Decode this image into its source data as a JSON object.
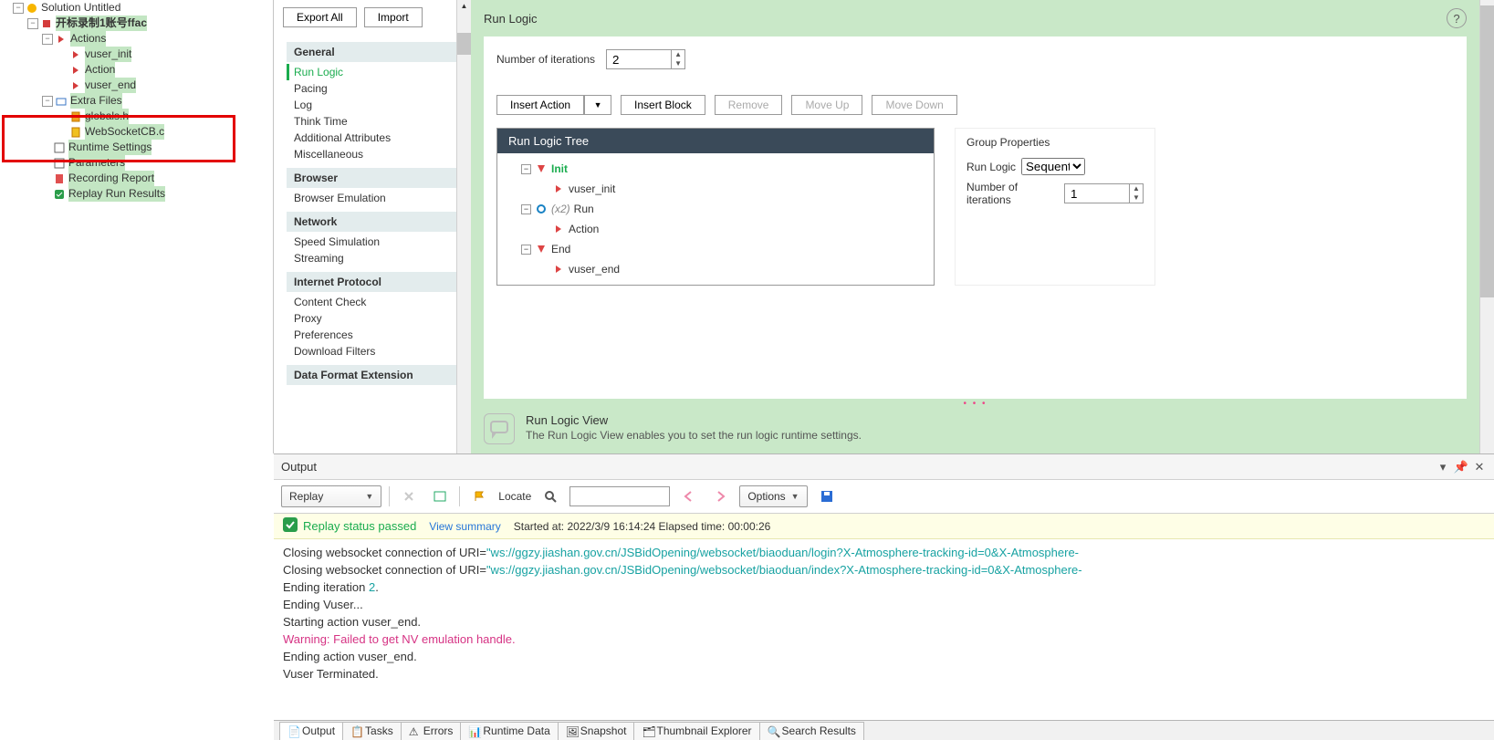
{
  "tree": {
    "root_label": "Solution Untitled",
    "script_label": "开标录制1账号ffac",
    "actions_label": "Actions",
    "actions": [
      "vuser_init",
      "Action",
      "vuser_end"
    ],
    "extra_files_label": "Extra Files",
    "extra_files": [
      "globals.h",
      "WebSocketCB.c"
    ],
    "runtime_settings": "Runtime Settings",
    "parameters": "Parameters",
    "recording_report": "Recording Report",
    "replay_run_results": "Replay Run Results"
  },
  "rts_bar": {
    "export": "Export All",
    "import": "Import"
  },
  "rts_categories": {
    "general_hdr": "General",
    "general": [
      "Run Logic",
      "Pacing",
      "Log",
      "Think Time",
      "Additional Attributes",
      "Miscellaneous"
    ],
    "browser_hdr": "Browser",
    "browser": [
      "Browser Emulation"
    ],
    "network_hdr": "Network",
    "network": [
      "Speed Simulation",
      "Streaming"
    ],
    "ip_hdr": "Internet Protocol",
    "ip": [
      "Content Check",
      "Proxy",
      "Preferences",
      "Download Filters"
    ],
    "dfe_hdr": "Data Format Extension"
  },
  "rts_main": {
    "title": "Run Logic",
    "iter_label": "Number of iterations",
    "iter_value": "2",
    "buttons": {
      "insert_action": "Insert Action",
      "insert_block": "Insert Block",
      "remove": "Remove",
      "move_up": "Move Up",
      "move_down": "Move Down"
    },
    "tree_hdr": "Run Logic Tree",
    "tree": {
      "init": "Init",
      "init_child": "vuser_init",
      "run_prefix": "(x2)",
      "run": "Run",
      "run_child": "Action",
      "end": "End",
      "end_child": "vuser_end"
    },
    "group_props": {
      "title": "Group Properties",
      "rl_label": "Run Logic",
      "rl_value": "Sequential",
      "ni_label": "Number of iterations",
      "ni_value": "1"
    },
    "info_title": "Run Logic View",
    "info_desc": "The Run Logic View enables you to set the run logic runtime settings."
  },
  "output": {
    "title": "Output",
    "combo": "Replay",
    "locate": "Locate",
    "options": "Options",
    "status_pass": "Replay status passed",
    "view_summary": "View summary",
    "started_at": "Started at: 2022/3/9 16:14:24 Elapsed time: 00:00:26",
    "console": {
      "close1_pre": "Closing websocket connection of URI=",
      "close1_uri": "\"ws://ggzy.jiashan.gov.cn/JSBidOpening/websocket/biaoduan/login?X-Atmosphere-tracking-id=0&X-Atmosphere-",
      "close2_pre": "Closing websocket connection of URI=",
      "close2_uri": "\"ws://ggzy.jiashan.gov.cn/JSBidOpening/websocket/biaoduan/index?X-Atmosphere-tracking-id=0&X-Atmosphere-",
      "end_iter_pre": "Ending iteration ",
      "end_iter_n": "2",
      "end_iter_post": ".",
      "end_vuser": "Ending Vuser...",
      "start_vend": "Starting action vuser_end.",
      "warn": "Warning: Failed to get NV emulation handle.",
      "end_vend": "Ending action vuser_end.",
      "term": "Vuser Terminated."
    }
  },
  "bottom_tabs": [
    "Output",
    "Tasks",
    "Errors",
    "Runtime Data",
    "Snapshot",
    "Thumbnail Explorer",
    "Search Results"
  ]
}
